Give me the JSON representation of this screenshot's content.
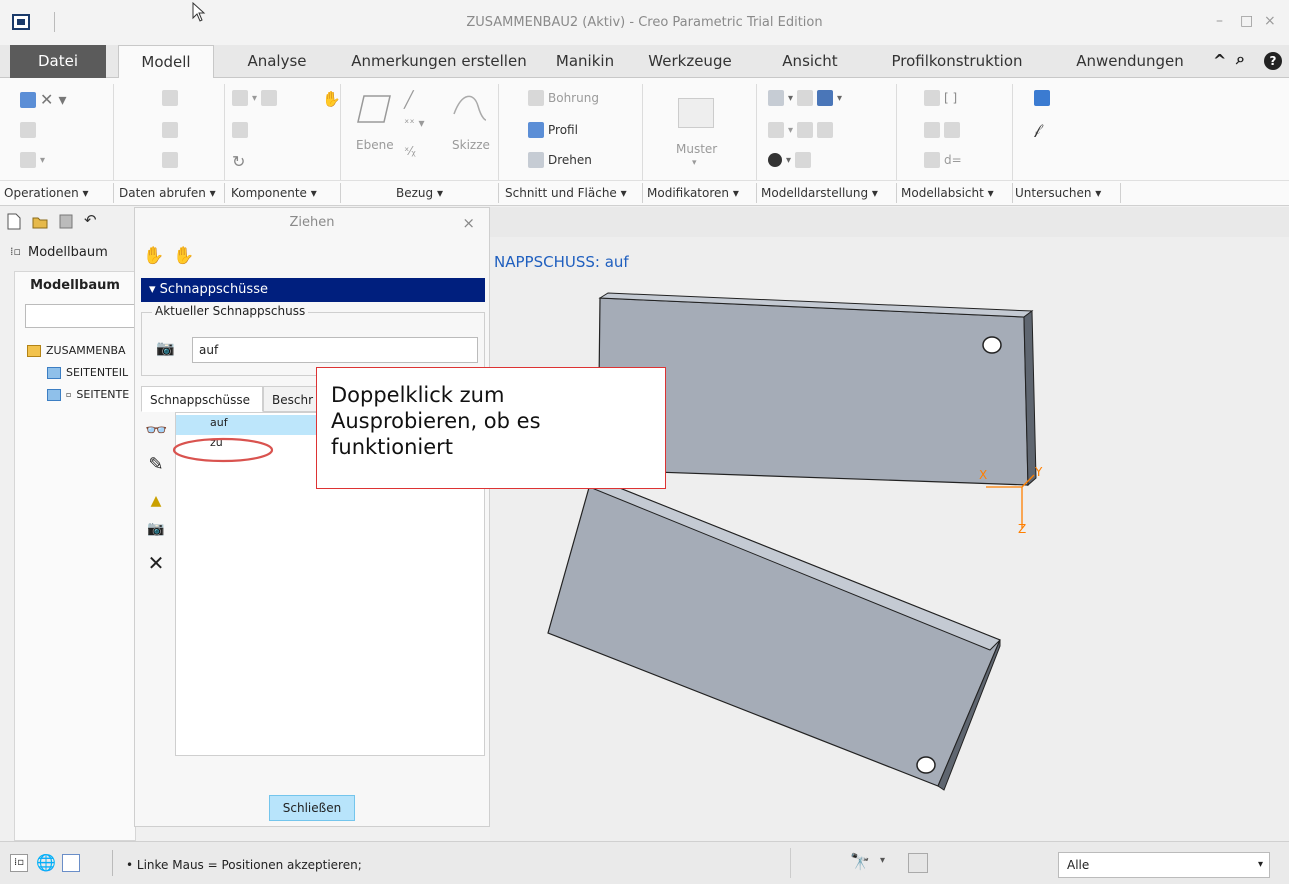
{
  "window": {
    "title": "ZUSAMMENBAU2 (Aktiv) - Creo Parametric Trial Edition",
    "minimize": "–",
    "maximize": "□",
    "close": "×"
  },
  "tabs": [
    {
      "label": "Datei"
    },
    {
      "label": "Modell"
    },
    {
      "label": "Analyse"
    },
    {
      "label": "Anmerkungen erstellen"
    },
    {
      "label": "Manikin"
    },
    {
      "label": "Werkzeuge"
    },
    {
      "label": "Ansicht"
    },
    {
      "label": "Profilkonstruktion"
    },
    {
      "label": "Anwendungen"
    }
  ],
  "tabs_right": {
    "collapse": "^",
    "search": "⌕",
    "help": "?"
  },
  "ribbon": {
    "ebene": "Ebene",
    "skizze": "Skizze",
    "bohrung": "Bohrung",
    "profil": "Profil",
    "drehen": "Drehen",
    "muster": "Muster",
    "d_eq": "d=",
    "groups": [
      "Operationen ▾",
      "Daten abrufen ▾",
      "Komponente ▾",
      "Bezug ▾",
      "Schnitt und Fläche ▾",
      "Modifikatoren ▾",
      "Modelldarstellung ▾",
      "Modellabsicht ▾",
      "Untersuchen ▾"
    ]
  },
  "left_panel": {
    "tab_label": "Modellbaum",
    "header": "Modellbaum",
    "tree": [
      {
        "label": "ZUSAMMENBA",
        "type": "assembly"
      },
      {
        "label": "SEITENTEIL",
        "type": "part"
      },
      {
        "label": "SEITENTE",
        "type": "part"
      }
    ]
  },
  "dialog": {
    "title": "Ziehen",
    "close": "×",
    "section": "Schnappschüsse",
    "current_legend": "Aktueller Schnappschuss",
    "current_value": "auf",
    "tab_snapshots": "Schnappschüsse",
    "tab_constraints": "Beschr",
    "snapshots": [
      "auf",
      "zu"
    ],
    "close_button": "Schließen"
  },
  "graphics": {
    "status_text": "NAPPSCHUSS: auf",
    "axis_x": "X",
    "axis_y": "Y",
    "axis_z": "Z"
  },
  "callout": {
    "line1": "Doppelklick zum",
    "line2": "Ausprobieren, ob es",
    "line3": "funktioniert"
  },
  "statusbar": {
    "message": "• Linke Maus = Positionen akzeptieren;",
    "filter": "Alle"
  },
  "colors": {
    "section_bar": "#001f7e",
    "selection": "#bde6fb",
    "callout_border": "#dd3333",
    "annotation_ellipse": "#d9534f",
    "part_face": "#a5acb7",
    "csys": "#ff7f00",
    "status_text": "#1f5fbf"
  }
}
